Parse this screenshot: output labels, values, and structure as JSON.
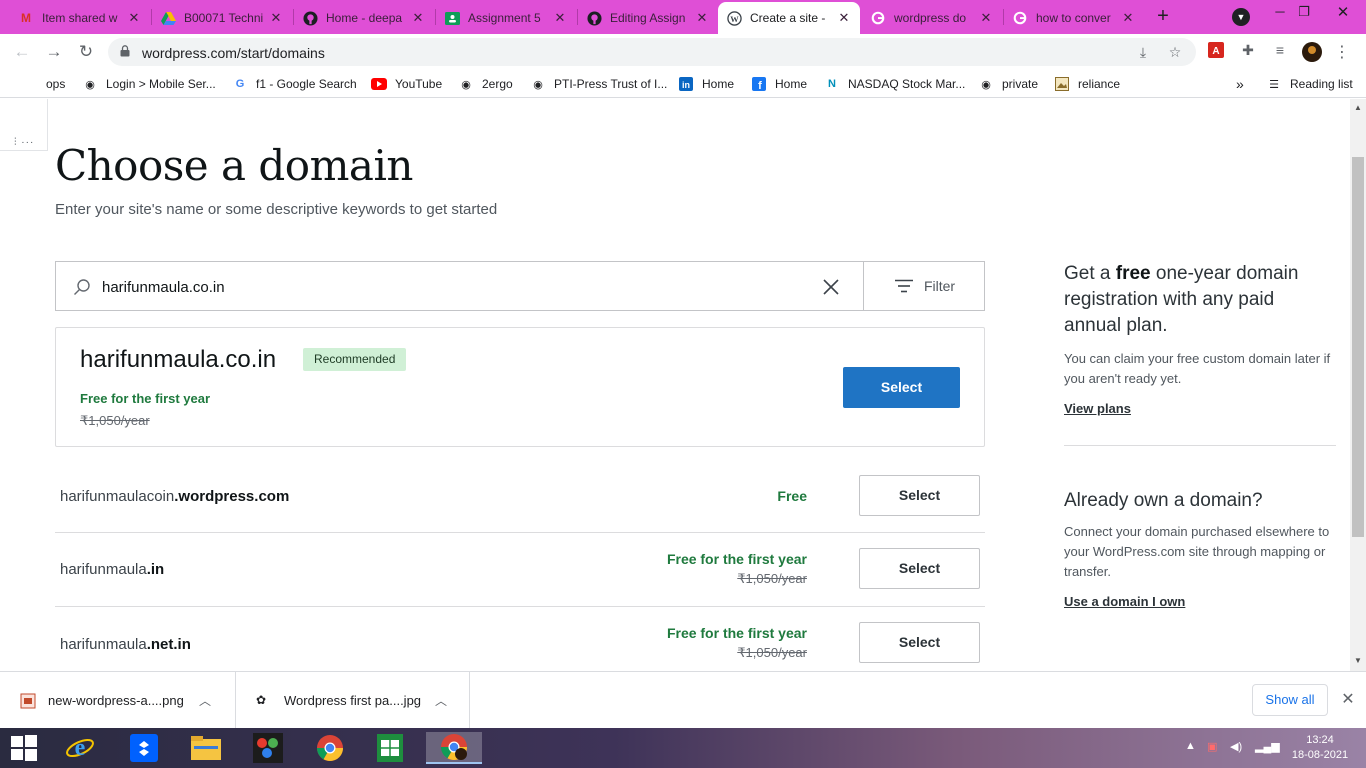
{
  "browser": {
    "tabs": [
      {
        "label": "Item shared w",
        "icon": "gmail-icon"
      },
      {
        "label": "B00071 Techni",
        "icon": "google-drive-icon"
      },
      {
        "label": "Home - deepa",
        "icon": "github-icon"
      },
      {
        "label": "Assignment 5",
        "icon": "google-classroom-icon"
      },
      {
        "label": "Editing Assign",
        "icon": "github-icon"
      },
      {
        "label": "Create a site -",
        "icon": "wordpress-icon",
        "active": true
      },
      {
        "label": "wordpress do",
        "icon": "google-icon"
      },
      {
        "label": "how to conver",
        "icon": "google-icon"
      }
    ],
    "new_tab": "+",
    "url": "wordpress.com/start/domains",
    "bookmarks": [
      {
        "label": "ops",
        "icon": "apps-icon"
      },
      {
        "label": "Login > Mobile Ser...",
        "icon": "globe-icon"
      },
      {
        "label": "f1 - Google Search",
        "icon": "google-icon"
      },
      {
        "label": "YouTube",
        "icon": "youtube-icon"
      },
      {
        "label": "2ergo",
        "icon": "globe-icon"
      },
      {
        "label": "PTI-Press Trust of I...",
        "icon": "globe-icon"
      },
      {
        "label": "Home",
        "icon": "linkedin-icon"
      },
      {
        "label": "Home",
        "icon": "facebook-icon"
      },
      {
        "label": "NASDAQ Stock Mar...",
        "icon": "nasdaq-icon"
      },
      {
        "label": "private",
        "icon": "globe-icon"
      },
      {
        "label": "reliance",
        "icon": "image-icon"
      }
    ],
    "more_bookmarks": "»",
    "reading_list": "Reading list"
  },
  "page": {
    "title": "Choose a domain",
    "subtitle": "Enter your site's name or some descriptive keywords to get started",
    "search": {
      "value": "harifunmaula.co.in",
      "filter_label": "Filter"
    },
    "recommended": {
      "domain": "harifunmaula.co.in",
      "badge": "Recommended",
      "price_note": "Free for the first year",
      "old_price": "₹1,050/year",
      "button": "Select"
    },
    "results": [
      {
        "name": "harifunmaulacoin",
        "tld": ".wordpress.com",
        "price_note": "Free",
        "old_price": "",
        "button": "Select"
      },
      {
        "name": "harifunmaula",
        "tld": ".in",
        "price_note": "Free for the first year",
        "old_price": "₹1,050/year",
        "button": "Select"
      },
      {
        "name": "harifunmaula",
        "tld": ".net.in",
        "price_note": "Free for the first year",
        "old_price": "₹1,050/year",
        "button": "Select"
      }
    ],
    "aside": {
      "promo_pre": "Get a ",
      "promo_bold": "free",
      "promo_post": " one-year domain registration with any paid annual plan.",
      "promo_text": "You can claim your free custom domain later if you aren't ready yet.",
      "promo_link": "View plans",
      "own_heading": "Already own a domain?",
      "own_text": "Connect your domain purchased elsewhere to your WordPress.com site through mapping or transfer.",
      "own_link": "Use a domain I own"
    }
  },
  "downloads": {
    "items": [
      {
        "name": "new-wordpress-a....png",
        "icon": "png-file-icon"
      },
      {
        "name": "Wordpress first pa....jpg",
        "icon": "jpg-file-icon"
      }
    ],
    "show_all": "Show all"
  },
  "taskbar": {
    "time": "13:24",
    "date": "18-08-2021"
  },
  "colors": {
    "tabstrip": "#df4fd6",
    "primary_button": "#1f74c4",
    "price_green": "#1f7a3e",
    "badge_bg": "#d0f0d6"
  }
}
